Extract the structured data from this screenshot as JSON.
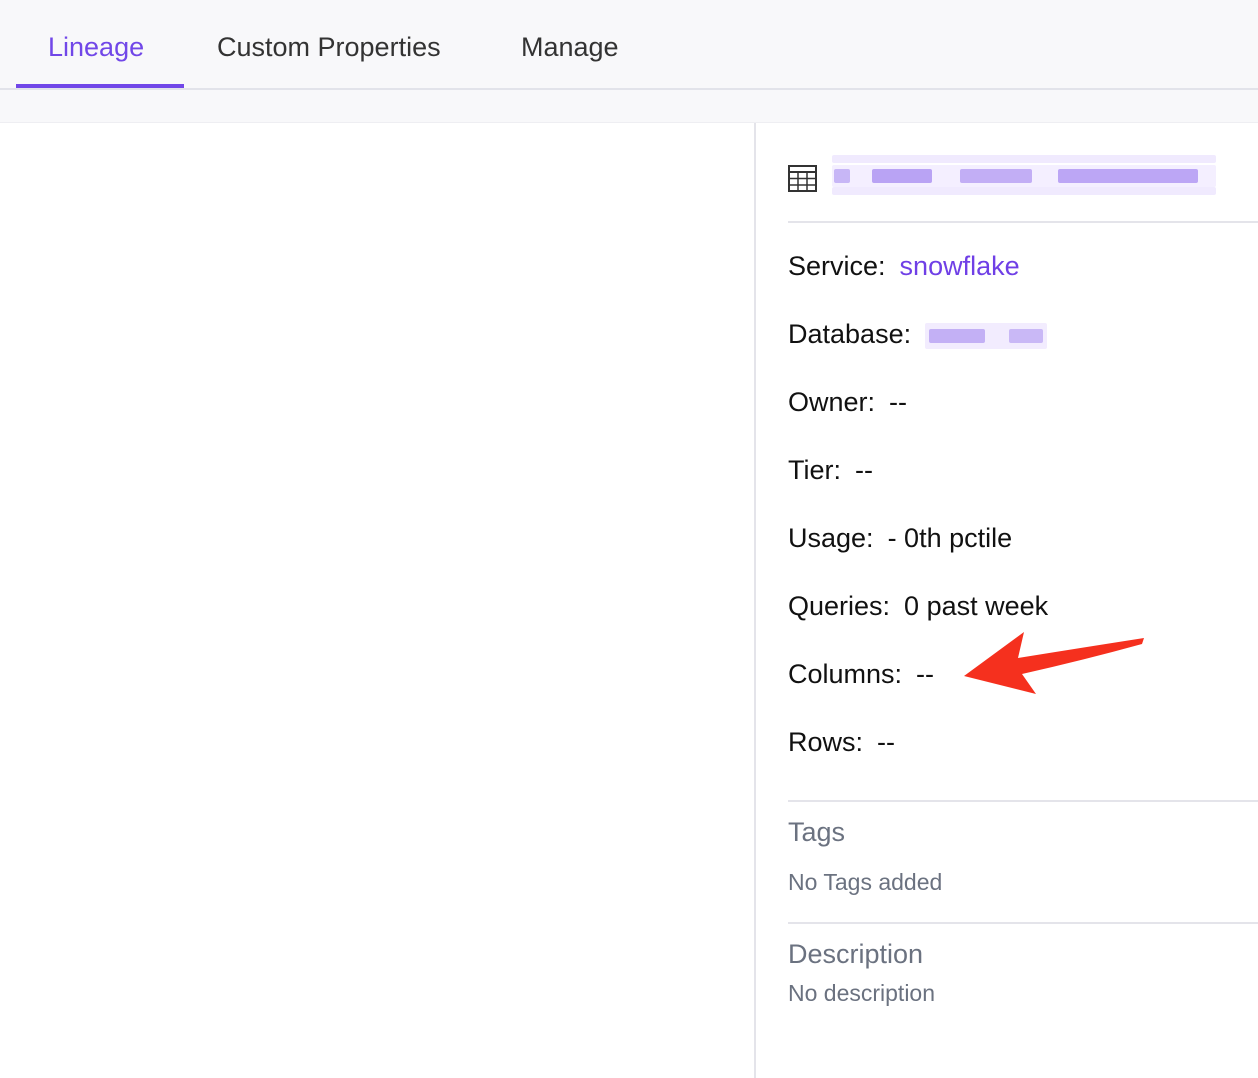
{
  "tabs": [
    {
      "label": "Lineage",
      "active": true
    },
    {
      "label": "Custom Properties",
      "active": false
    },
    {
      "label": "Manage",
      "active": false
    }
  ],
  "entity": {
    "icon": "table-icon",
    "name": ""
  },
  "details": {
    "service_label": "Service:",
    "service_value": "snowflake",
    "database_label": "Database:",
    "database_value": "",
    "owner_label": "Owner:",
    "owner_value": "--",
    "tier_label": "Tier:",
    "tier_value": "--",
    "usage_label": "Usage:",
    "usage_value": "- 0th pctile",
    "queries_label": "Queries:",
    "queries_value": "0 past week",
    "columns_label": "Columns:",
    "columns_value": "--",
    "rows_label": "Rows:",
    "rows_value": "--"
  },
  "tags": {
    "title": "Tags",
    "empty_text": "No Tags added"
  },
  "description": {
    "title": "Description",
    "empty_text": "No description"
  },
  "colors": {
    "accent": "#7147e8",
    "link": "#6f3fe6",
    "annotation_arrow": "#f5301e",
    "muted_text": "#6b7280"
  }
}
